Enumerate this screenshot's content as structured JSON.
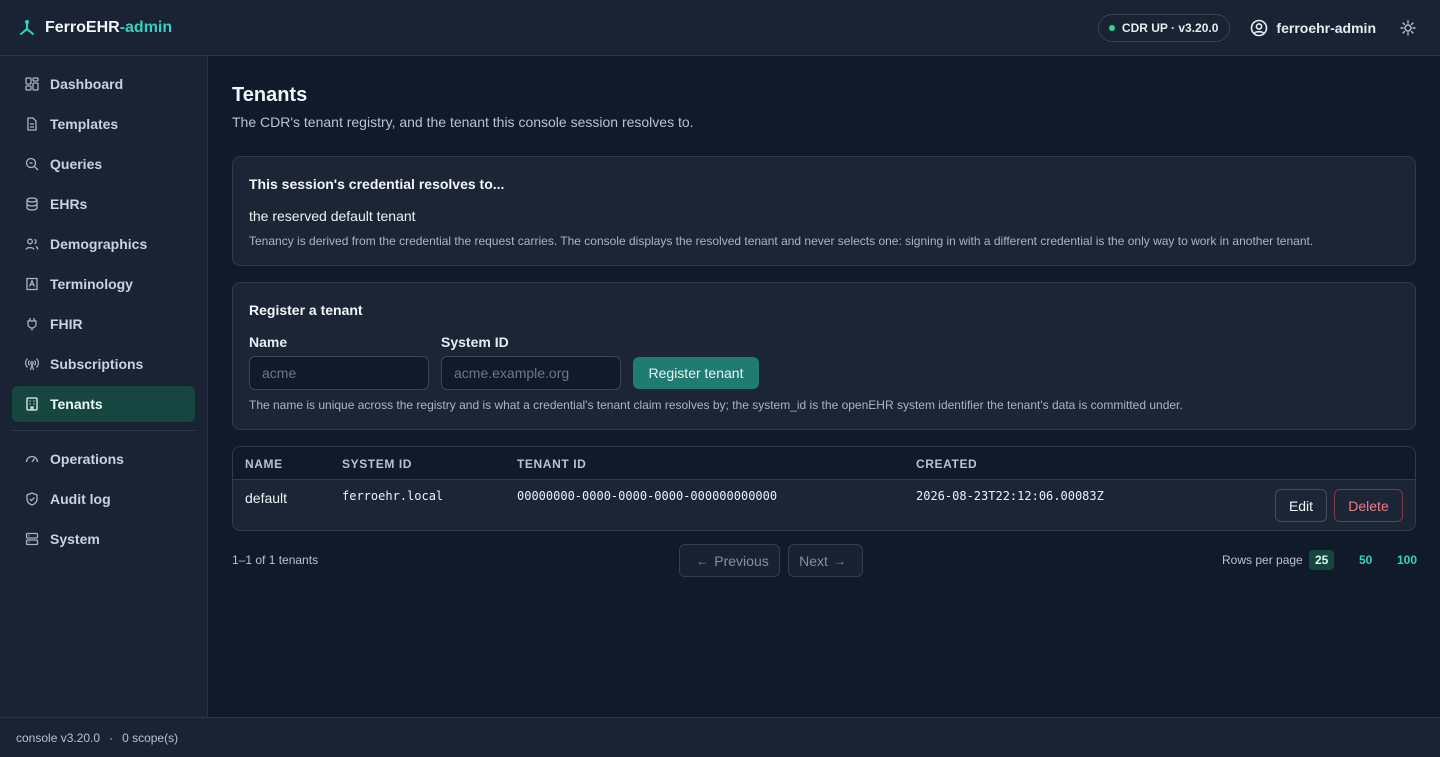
{
  "brand": {
    "name": "FerroEHR",
    "suffix": "-admin"
  },
  "header": {
    "status": "CDR UP · v3.20.0",
    "user": "ferroehr-admin"
  },
  "sidebar": {
    "items": [
      {
        "label": "Dashboard",
        "icon": "dashboard-icon"
      },
      {
        "label": "Templates",
        "icon": "templates-icon"
      },
      {
        "label": "Queries",
        "icon": "queries-icon"
      },
      {
        "label": "EHRs",
        "icon": "ehrs-icon"
      },
      {
        "label": "Demographics",
        "icon": "demographics-icon"
      },
      {
        "label": "Terminology",
        "icon": "terminology-icon"
      },
      {
        "label": "FHIR",
        "icon": "fhir-icon"
      },
      {
        "label": "Subscriptions",
        "icon": "subscriptions-icon"
      },
      {
        "label": "Tenants",
        "icon": "tenants-icon",
        "active": true
      }
    ],
    "secondary": [
      {
        "label": "Operations",
        "icon": "operations-icon"
      },
      {
        "label": "Audit log",
        "icon": "audit-log-icon"
      },
      {
        "label": "System",
        "icon": "system-icon"
      }
    ]
  },
  "footer": {
    "version": "console v3.20.0",
    "separator": "·",
    "scopes": "0 scope(s)"
  },
  "page": {
    "title": "Tenants",
    "subtitle": "The CDR's tenant registry, and the tenant this console session resolves to."
  },
  "session": {
    "title": "This session's credential resolves to...",
    "value": "the reserved default tenant",
    "note": "Tenancy is derived from the credential the request carries. The console displays the resolved tenant and never selects one: signing in with a different credential is the only way to work in another tenant."
  },
  "register": {
    "title": "Register a tenant",
    "name_label": "Name",
    "name_placeholder": "acme",
    "system_label": "System ID",
    "system_placeholder": "acme.example.org",
    "button": "Register tenant",
    "note": "The name is unique across the registry and is what a credential's tenant claim resolves by; the system_id is the openEHR system identifier the tenant's data is committed under."
  },
  "table": {
    "columns": [
      "NAME",
      "SYSTEM ID",
      "TENANT ID",
      "CREATED"
    ],
    "rows": [
      {
        "name": "default",
        "system_id": "ferroehr.local",
        "tenant_id": "00000000-0000-0000-0000-000000000000",
        "created": "2026-08-23T22:12:06.00083Z",
        "edit": "Edit",
        "delete": "Delete"
      }
    ]
  },
  "pager": {
    "count": "1–1 of 1 tenants",
    "previous": "Previous",
    "next": "Next",
    "rows_label": "Rows per page",
    "rows_options": [
      "25",
      "50",
      "100"
    ],
    "rows_selected": "25"
  },
  "colors": {
    "accent": "#2dd4bf",
    "active_bg": "#17453f",
    "danger": "#f17a85",
    "primary_button": "#207b73"
  }
}
